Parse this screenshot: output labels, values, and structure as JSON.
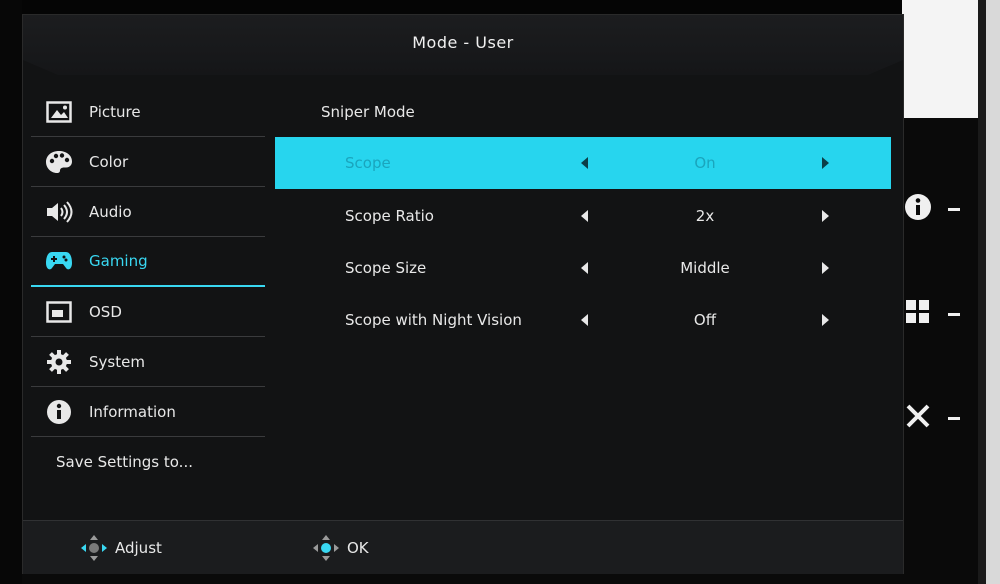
{
  "osd": {
    "title": "Mode - User"
  },
  "sidebar": {
    "items": [
      {
        "label": "Picture",
        "icon": "picture-icon"
      },
      {
        "label": "Color",
        "icon": "palette-icon"
      },
      {
        "label": "Audio",
        "icon": "speaker-icon"
      },
      {
        "label": "Gaming",
        "icon": "gamepad-icon",
        "active": true
      },
      {
        "label": "OSD",
        "icon": "osd-window-icon"
      },
      {
        "label": "System",
        "icon": "gear-icon"
      },
      {
        "label": "Information",
        "icon": "info-icon"
      },
      {
        "label": "Save Settings to..."
      }
    ]
  },
  "main": {
    "section_title": "Sniper Mode",
    "options": [
      {
        "name": "Scope",
        "value": "On",
        "selected": true
      },
      {
        "name": "Scope Ratio",
        "value": "2x"
      },
      {
        "name": "Scope Size",
        "value": "Middle"
      },
      {
        "name": "Scope with Night Vision",
        "value": "Off"
      }
    ]
  },
  "footer": {
    "adjust_label": "Adjust",
    "ok_label": "OK"
  },
  "hotkeys": [
    {
      "icon": "info-icon"
    },
    {
      "icon": "grid-icon"
    },
    {
      "icon": "close-icon"
    }
  ],
  "colors": {
    "accent": "#39d8f2",
    "selected_row": "#27d5ee",
    "panel": "#121314"
  }
}
